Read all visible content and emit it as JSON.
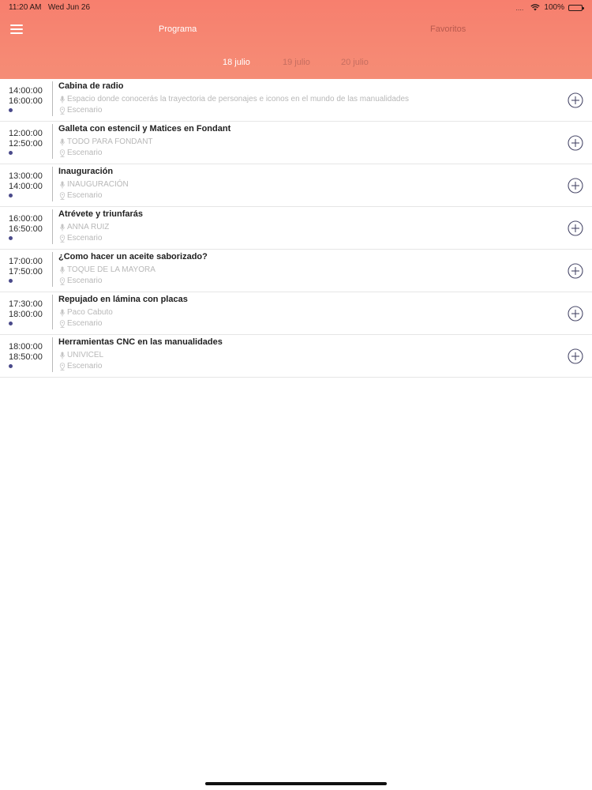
{
  "status": {
    "time": "11:20 AM",
    "date": "Wed Jun 26",
    "dots": "....",
    "battery": "100%"
  },
  "tabs": {
    "programa": "Programa",
    "favoritos": "Favoritos"
  },
  "dates": [
    "18 julio",
    "19 julio",
    "20 julio"
  ],
  "colors": {
    "header": "#f77f6e",
    "active_tab": "#ffffff",
    "inactive_tab": "#b85a4e",
    "accent": "#4a4a8a"
  },
  "events": [
    {
      "start": "14:00:00",
      "end": "16:00:00",
      "title": "Cabina de radio",
      "speaker": "Espacio donde conocerás la trayectoria de personajes e iconos en el mundo de las manualidades",
      "place": "Escenario"
    },
    {
      "start": "12:00:00",
      "end": "12:50:00",
      "title": "Galleta con estencil y Matices en Fondant",
      "speaker": "TODO PARA FONDANT",
      "place": "Escenario"
    },
    {
      "start": "13:00:00",
      "end": "14:00:00",
      "title": "Inauguración",
      "speaker": "INAUGURACIÓN",
      "place": "Escenario"
    },
    {
      "start": "16:00:00",
      "end": "16:50:00",
      "title": "Atrévete y triunfarás",
      "speaker": "ANNA RUIZ",
      "place": "Escenario"
    },
    {
      "start": "17:00:00",
      "end": "17:50:00",
      "title": "¿Como hacer un aceite saborizado?",
      "speaker": "TOQUE DE LA MAYORA",
      "place": "Escenario"
    },
    {
      "start": "17:30:00",
      "end": "18:00:00",
      "title": "Repujado en lámina con placas",
      "speaker": "Paco Cabuto",
      "place": "Escenario"
    },
    {
      "start": "18:00:00",
      "end": "18:50:00",
      "title": "Herramientas CNC en las manualidades",
      "speaker": "UNIVICEL",
      "place": "Escenario"
    }
  ]
}
